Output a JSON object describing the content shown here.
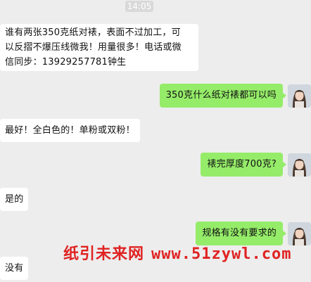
{
  "chat": {
    "timestamp": "14:05",
    "messages": [
      {
        "side": "left",
        "lines": [
          "谁有两张350克纸对裱，表面不过加工，可",
          "以反摺不爆压线微我！用量很多！电话或微",
          "信同步：13929257781钟生"
        ]
      },
      {
        "side": "right",
        "text": "350克什么纸对裱都可以吗"
      },
      {
        "side": "left",
        "text": "最好！全白色的！单粉或双粉！"
      },
      {
        "side": "right",
        "text": "裱完厚度700克?"
      },
      {
        "side": "left",
        "text": "是的"
      },
      {
        "side": "right",
        "text": "规格有没有要求的"
      },
      {
        "side": "left",
        "text": "没有"
      }
    ]
  },
  "watermark": {
    "name": "纸引未来网",
    "url": "www.51zywl.com"
  }
}
